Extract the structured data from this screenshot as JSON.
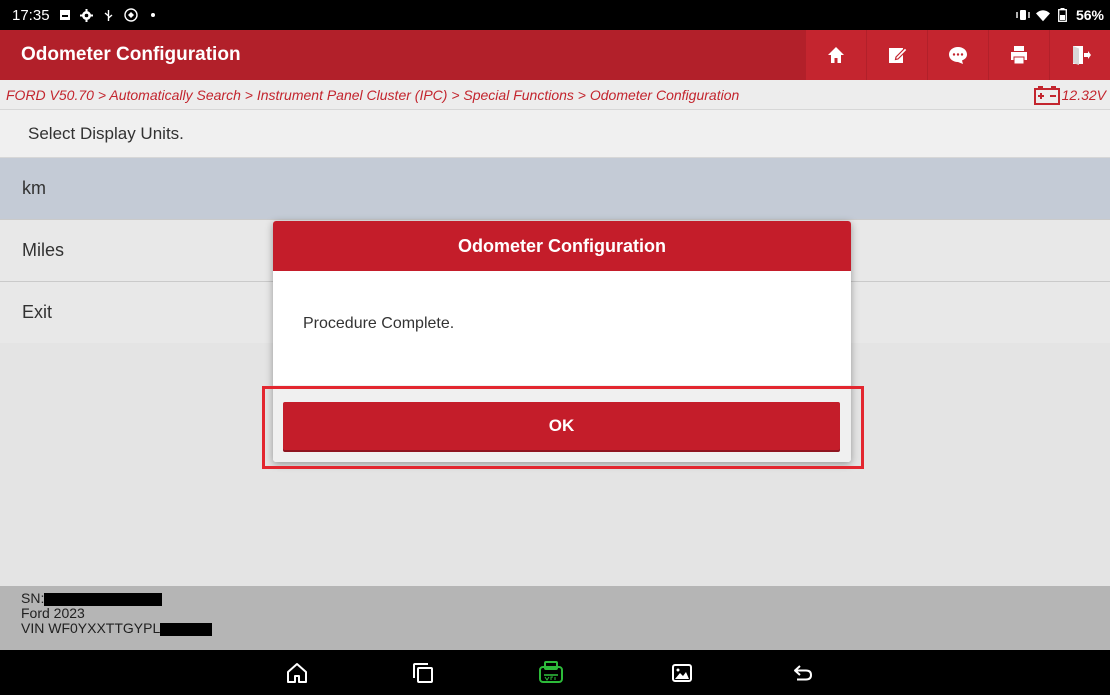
{
  "status_bar": {
    "time": "17:35",
    "battery_percent": "56%",
    "icons_left": [
      "screen-icon",
      "gear-icon",
      "usb-icon",
      "notification-icon",
      "dot-icon"
    ],
    "icons_right": [
      "vibrate-icon",
      "wifi-icon",
      "battery-icon"
    ]
  },
  "header": {
    "title": "Odometer Configuration",
    "toolbar": [
      {
        "name": "home-icon"
      },
      {
        "name": "edit-report-icon"
      },
      {
        "name": "chat-icon"
      },
      {
        "name": "print-icon"
      },
      {
        "name": "exit-icon"
      }
    ]
  },
  "breadcrumb": {
    "path": "FORD V50.70 > Automatically Search > Instrument Panel Cluster (IPC) > Special Functions > Odometer Configuration",
    "voltage": "12.32V"
  },
  "content": {
    "prompt": "Select Display Units.",
    "items": [
      {
        "label": "km",
        "selected": true
      },
      {
        "label": "Miles",
        "selected": false
      },
      {
        "label": "Exit",
        "selected": false
      }
    ]
  },
  "info": {
    "sn_label": "SN:",
    "vehicle": "Ford  2023",
    "vin_prefix": "VIN WF0YXXTTGYPL"
  },
  "dialog": {
    "title": "Odometer Configuration",
    "message": "Procedure Complete.",
    "ok_label": "OK"
  },
  "nav": {
    "buttons": [
      "home-icon",
      "recent-apps-icon",
      "vci-icon",
      "screenshot-icon",
      "back-icon"
    ]
  },
  "colors": {
    "brand_red": "#c41d2a",
    "selected_row": "#c8d0db",
    "highlight": "#e3262f"
  }
}
